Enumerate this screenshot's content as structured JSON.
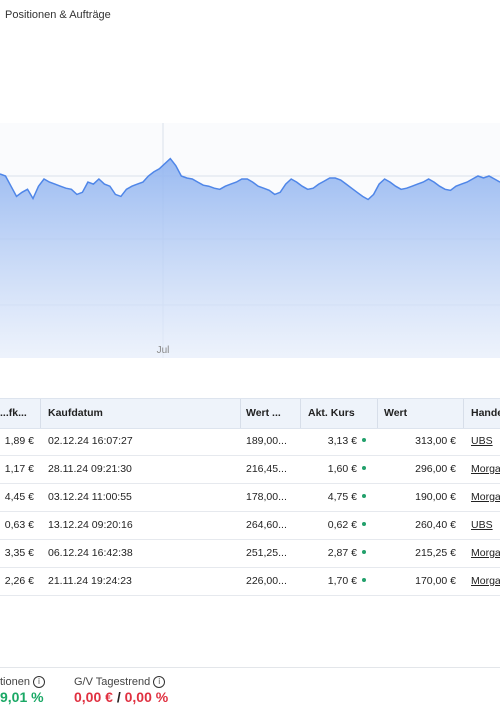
{
  "header": {
    "tab_label": "Positionen & Aufträge"
  },
  "chart_data": {
    "type": "area",
    "x_tick_labels": [
      "Jul"
    ],
    "series": [
      {
        "values": [
          180,
          178,
          168,
          158,
          162,
          165,
          156,
          168,
          175,
          172,
          170,
          168,
          166,
          165,
          160,
          162,
          172,
          170,
          175,
          170,
          168,
          160,
          158,
          165,
          168,
          170,
          172,
          178,
          182,
          185,
          190,
          195,
          188,
          178,
          176,
          175,
          172,
          169,
          168,
          166,
          165,
          168,
          170,
          172,
          175,
          175,
          172,
          168,
          166,
          164,
          160,
          162,
          170,
          175,
          172,
          168,
          165,
          166,
          170,
          173,
          176,
          176,
          174,
          170,
          166,
          162,
          158,
          155,
          160,
          170,
          175,
          172,
          168,
          165,
          166,
          168,
          170,
          172,
          175,
          172,
          168,
          165,
          164,
          168,
          170,
          172,
          175,
          178,
          176,
          178,
          175,
          172
        ]
      }
    ],
    "color": "#4f86e8"
  },
  "table": {
    "columns": [
      "...fk...",
      "Kaufdatum",
      "Wert ...",
      "Akt. Kurs",
      "Wert",
      "Hande"
    ],
    "rows": [
      {
        "buy_price": "1,89 €",
        "date": "02.12.24 16:07:27",
        "buy_value": "189,00...",
        "price": "3,13 €",
        "value": "313,00 €",
        "venue": "UBS"
      },
      {
        "buy_price": "1,17 €",
        "date": "28.11.24 09:21:30",
        "buy_value": "216,45...",
        "price": "1,60 €",
        "value": "296,00 €",
        "venue": "Morga"
      },
      {
        "buy_price": "4,45 €",
        "date": "03.12.24 11:00:55",
        "buy_value": "178,00...",
        "price": "4,75 €",
        "value": "190,00 €",
        "venue": "Morga"
      },
      {
        "buy_price": "0,63 €",
        "date": "13.12.24 09:20:16",
        "buy_value": "264,60...",
        "price": "0,62 €",
        "value": "260,40 €",
        "venue": "UBS"
      },
      {
        "buy_price": "3,35 €",
        "date": "06.12.24 16:42:38",
        "buy_value": "251,25...",
        "price": "2,87 €",
        "value": "215,25 €",
        "venue": "Morga"
      },
      {
        "buy_price": "2,26 €",
        "date": "21.11.24 19:24:23",
        "buy_value": "226,00...",
        "price": "1,70 €",
        "value": "170,00 €",
        "venue": "Morga"
      }
    ]
  },
  "footer": {
    "left_label": "tionen",
    "left_value": "9,01 %",
    "trend_label": "G/V Tagestrend",
    "trend_eur": "0,00 €",
    "trend_sep": "/",
    "trend_pct": "0,00 %",
    "info_glyph": "i"
  }
}
